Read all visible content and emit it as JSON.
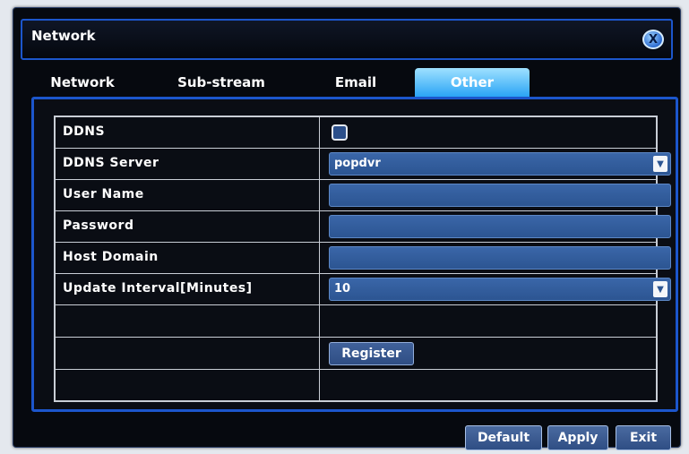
{
  "window": {
    "title": "Network",
    "close_label": "X"
  },
  "tabs": [
    {
      "label": "Network",
      "active": false
    },
    {
      "label": "Sub-stream",
      "active": false
    },
    {
      "label": "Email",
      "active": false
    },
    {
      "label": "Other",
      "active": true
    }
  ],
  "form": {
    "ddns": {
      "label": "DDNS",
      "checked": false
    },
    "ddns_server": {
      "label": "DDNS Server",
      "value": "popdvr"
    },
    "user_name": {
      "label": "User Name",
      "value": ""
    },
    "password": {
      "label": "Password",
      "value": ""
    },
    "host_domain": {
      "label": "Host Domain",
      "value": ""
    },
    "update_interval": {
      "label": "Update Interval[Minutes]",
      "value": "10"
    },
    "register_label": "Register"
  },
  "footer": {
    "default_label": "Default",
    "apply_label": "Apply",
    "exit_label": "Exit"
  },
  "colors": {
    "accent": "#1c56cc",
    "active_tab": "#2aa4f5",
    "field": "#2c5592",
    "background": "#06090f"
  }
}
